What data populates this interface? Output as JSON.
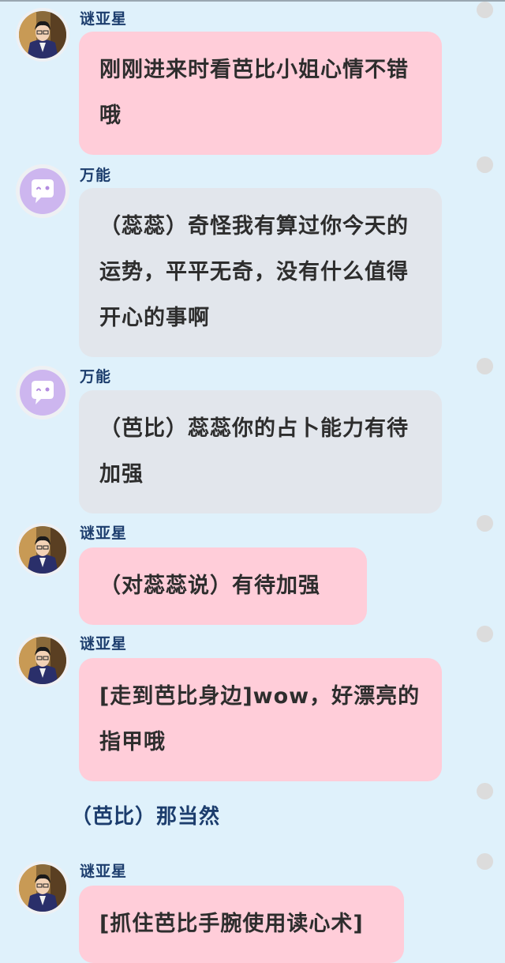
{
  "messages": [
    {
      "type": "user",
      "sender": "谜亚星",
      "style": "pink",
      "text": "刚刚进来时看芭比小姐心情不错哦"
    },
    {
      "type": "bot",
      "sender": "万能",
      "style": "gray",
      "text": "（蕊蕊）奇怪我有算过你今天的运势，平平无奇，没有什么值得开心的事啊"
    },
    {
      "type": "bot",
      "sender": "万能",
      "style": "gray",
      "text": "（芭比）蕊蕊你的占卜能力有待加强"
    },
    {
      "type": "user",
      "sender": "谜亚星",
      "style": "pink",
      "text": "（对蕊蕊说）有待加强"
    },
    {
      "type": "user",
      "sender": "谜亚星",
      "style": "pink",
      "text": "[走到芭比身边]wow，好漂亮的指甲哦"
    },
    {
      "type": "narration",
      "text": "（芭比）那当然"
    },
    {
      "type": "user",
      "sender": "谜亚星",
      "style": "pink",
      "text": "[抓住芭比手腕使用读心术]"
    }
  ],
  "icons": {
    "user_avatar": "person-photo-avatar",
    "bot_avatar": "chat-bubble-face-icon",
    "more": "dot-icon"
  },
  "colors": {
    "background": "#dff1fb",
    "user_bubble": "#ffcdd9",
    "bot_bubble": "#e2e6ec",
    "name_text": "#1c3d6d",
    "bot_avatar": "#cdb6ef"
  }
}
